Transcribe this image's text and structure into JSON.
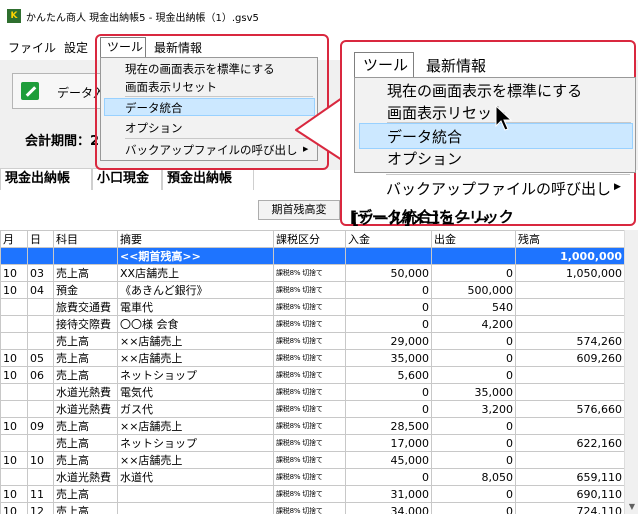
{
  "window": {
    "title": "かんたん商人 現金出納帳5 - 現金出納帳（1）.gsv5",
    "app_icon": "app-logo-icon"
  },
  "menubar": {
    "items": [
      "ファイル",
      "設定",
      "ツール",
      "最新情報"
    ]
  },
  "toolbar": {
    "data_button_label": "データ入"
  },
  "period": {
    "label": "会計期間：2"
  },
  "tabs": [
    "現金出納帳",
    "小口現金",
    "預金出納帳"
  ],
  "opening_balance_button": "期首残高変",
  "tool_menu": {
    "header": "ツール",
    "latest": "最新情報",
    "items": [
      "現在の画面表示を標準にする",
      "画面表示リセット",
      "データ統合",
      "オプション",
      "バックアップファイルの呼び出し"
    ],
    "selected_index": 2,
    "submenu_arrow": "▶"
  },
  "callout": {
    "line1": "[ツール]メニュー →",
    "line2": "[データ統合]をクリック"
  },
  "table": {
    "headers": [
      "月",
      "日",
      "科目",
      "摘要",
      "課税区分",
      "入金",
      "出金",
      "残高"
    ],
    "rows": [
      [
        "",
        "",
        "",
        "<<期首残高>>",
        "",
        "",
        "",
        "1,000,000"
      ],
      [
        "10",
        "03",
        "売上高",
        "XX店舗売上",
        "課税8% 切捨て",
        "50,000",
        "0",
        "1,050,000"
      ],
      [
        "10",
        "04",
        "預金",
        "《あきんど銀行》",
        "課税8% 切捨て",
        "0",
        "500,000",
        ""
      ],
      [
        "",
        "",
        "旅費交通費",
        "電車代",
        "課税8% 切捨て",
        "0",
        "540",
        ""
      ],
      [
        "",
        "",
        "接待交際費",
        "〇〇様 会食",
        "課税8% 切捨て",
        "0",
        "4,200",
        ""
      ],
      [
        "",
        "",
        "売上高",
        "××店舗売上",
        "課税8% 切捨て",
        "29,000",
        "0",
        "574,260"
      ],
      [
        "10",
        "05",
        "売上高",
        "××店舗売上",
        "課税8% 切捨て",
        "35,000",
        "0",
        "609,260"
      ],
      [
        "10",
        "06",
        "売上高",
        "ネットショップ",
        "課税8% 切捨て",
        "5,600",
        "0",
        ""
      ],
      [
        "",
        "",
        "水道光熱費",
        "電気代",
        "課税8% 切捨て",
        "0",
        "35,000",
        ""
      ],
      [
        "",
        "",
        "水道光熱費",
        "ガス代",
        "課税8% 切捨て",
        "0",
        "3,200",
        "576,660"
      ],
      [
        "10",
        "09",
        "売上高",
        "××店舗売上",
        "課税8% 切捨て",
        "28,500",
        "0",
        ""
      ],
      [
        "",
        "",
        "売上高",
        "ネットショップ",
        "課税8% 切捨て",
        "17,000",
        "0",
        "622,160"
      ],
      [
        "10",
        "10",
        "売上高",
        "××店舗売上",
        "課税8% 切捨て",
        "45,000",
        "0",
        ""
      ],
      [
        "",
        "",
        "水道光熱費",
        "水道代",
        "課税8% 切捨て",
        "0",
        "8,050",
        "659,110"
      ],
      [
        "10",
        "11",
        "売上高",
        "",
        "課税8% 切捨て",
        "31,000",
        "0",
        "690,110"
      ],
      [
        "10",
        "12",
        "売上高",
        "",
        "課税8% 切捨て",
        "34,000",
        "0",
        "724,110"
      ]
    ]
  },
  "colors": {
    "callout_border": "#d9283f",
    "highlight_row": "#1e74ff",
    "menu_selected": "#cce8ff"
  }
}
